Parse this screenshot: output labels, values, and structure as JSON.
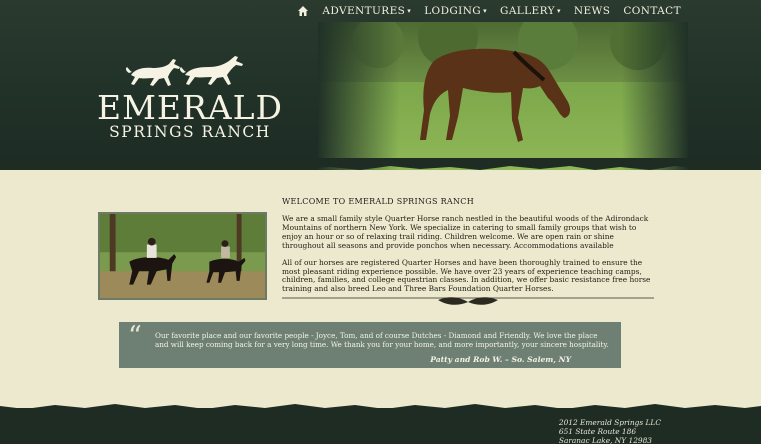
{
  "nav": {
    "items": [
      {
        "label": "ADVENTURES",
        "dropdown": true
      },
      {
        "label": "LODGING",
        "dropdown": true
      },
      {
        "label": "GALLERY",
        "dropdown": true
      },
      {
        "label": "NEWS",
        "dropdown": false
      },
      {
        "label": "CONTACT",
        "dropdown": false
      }
    ]
  },
  "logo": {
    "name": "EMERALD",
    "subtitle": "SPRINGS RANCH"
  },
  "main": {
    "title": "WELCOME TO EMERALD SPRINGS RANCH",
    "paragraphs": [
      "We are a small family style Quarter Horse ranch nestled in the beautiful woods of the Adirondack Mountains of northern New York. We specialize in catering to small family groups that wish to enjoy an hour or so of relaxing trail riding. Children welcome. We are open rain or shine throughout all seasons and provide ponchos when necessary. Accommodations available",
      "All of our horses are registered Quarter Horses and have been thoroughly trained to ensure the most pleasant riding experience possible. We have over 23 years of experience teaching camps, children, families, and college equestrian classes. In addition, we offer basic resistance free horse training and also breed Leo and Three Bars Foundation Quarter Horses."
    ]
  },
  "testimonial": {
    "quote": "Our favorite place and our favorite people - Joyce, Tom, and of course Dutches - Diamond and Friendly. We love the place and will keep coming back for a very long time. We thank you for your home, and more importantly, your sincere hospitality.",
    "author": "Patty and Rob W. – So. Salem, NY"
  },
  "footer": {
    "line1": "2012 Emerald Springs LLC",
    "line2": "651 State Route 186",
    "line3": "Saranac Lake, NY 12983"
  },
  "colors": {
    "header_bg": "#203127",
    "page_bg": "#ede9cf",
    "testimonial_bg": "#6e8073",
    "text": "#1d1d14"
  }
}
